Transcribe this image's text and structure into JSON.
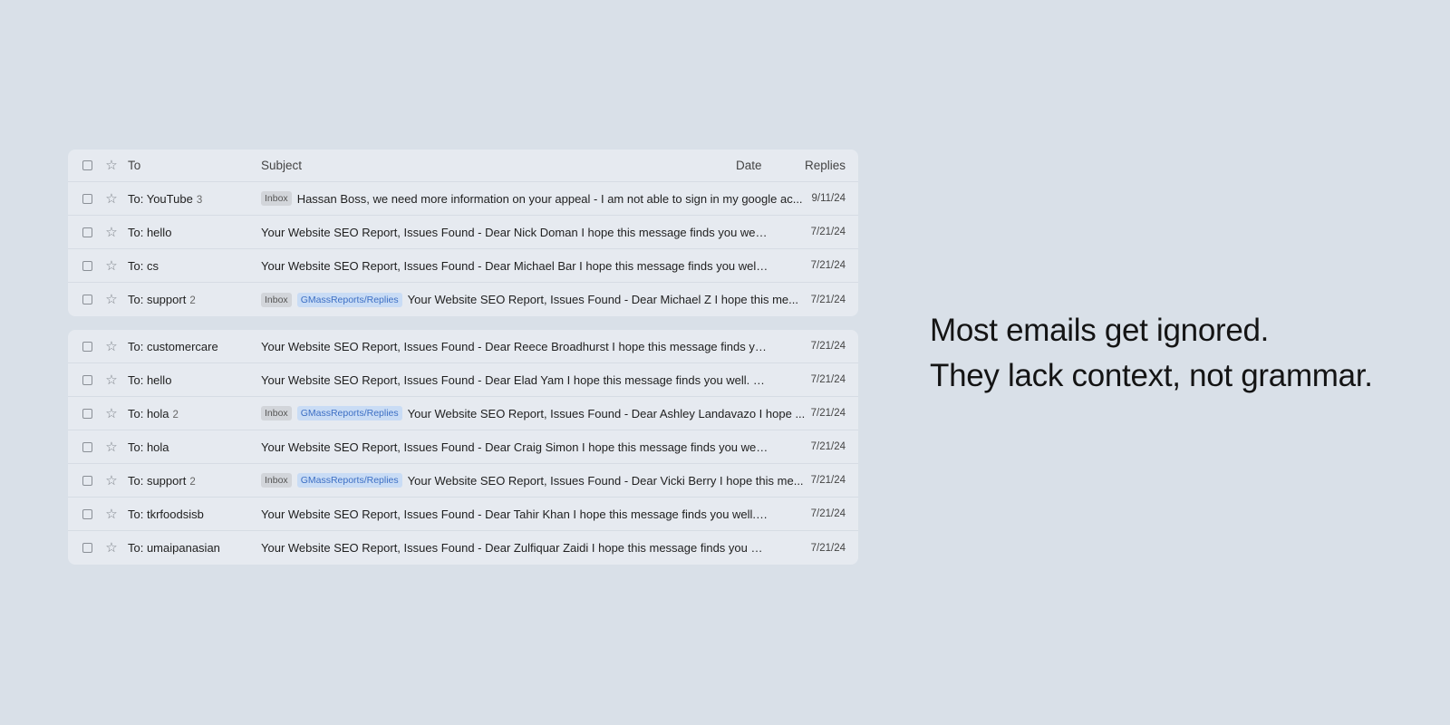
{
  "header": {
    "to_label": "To",
    "subject_label": "Subject",
    "date_label": "Date",
    "replies_label": "Replies"
  },
  "chips": {
    "inbox": "Inbox",
    "label": "GMassReports/Replies"
  },
  "rows_top": [
    {
      "to": "To: YouTube",
      "count": "3",
      "subject": "Hassan Boss, we need more information on your appeal - I am not able to sign in my google ac...",
      "date": "9/11/24"
    },
    {
      "to": "To: hello",
      "count": "",
      "subject": "Your Website SEO Report, Issues Found - Dear Nick Doman I hope this message finds you well. My na...",
      "date": "7/21/24"
    },
    {
      "to": "To: cs",
      "count": "",
      "subject": "Your Website SEO Report, Issues Found - Dear Michael Bar I hope this message finds you well. My na...",
      "date": "7/21/24"
    },
    {
      "to": "To: support",
      "count": "2",
      "subject": "Your Website SEO Report, Issues Found - Dear Michael Z I hope this me...",
      "date": "7/21/24"
    }
  ],
  "rows_bottom": [
    {
      "to": "To: customercare",
      "count": "",
      "subject": "Your Website SEO Report, Issues Found - Dear Reece Broadhurst I hope this message finds you well. ...",
      "date": "7/21/24"
    },
    {
      "to": "To: hello",
      "count": "",
      "subject": "Your Website SEO Report, Issues Found - Dear Elad Yam I hope this message finds you well. My nam...",
      "date": "7/21/24"
    },
    {
      "to": "To: hola",
      "count": "2",
      "subject": "Your Website SEO Report, Issues Found - Dear Ashley Landavazo I hope ...",
      "date": "7/21/24"
    },
    {
      "to": "To: hola",
      "count": "",
      "subject": "Your Website SEO Report, Issues Found - Dear Craig Simon I hope this message finds you well. My na...",
      "date": "7/21/24"
    },
    {
      "to": "To: support",
      "count": "2",
      "subject": "Your Website SEO Report, Issues Found - Dear Vicki Berry I hope this me...",
      "date": "7/21/24"
    },
    {
      "to": "To: tkrfoodsisb",
      "count": "",
      "subject": "Your Website SEO Report, Issues Found - Dear Tahir Khan I hope this message finds you well. My nam...",
      "date": "7/21/24"
    },
    {
      "to": "To: umaipanasian",
      "count": "",
      "subject": "Your Website SEO Report, Issues Found - Dear Zulfiquar Zaidi I hope this message finds you well. My n...",
      "date": "7/21/24"
    }
  ],
  "tagline": {
    "line1": "Most emails get ignored.",
    "line2": "They lack context, not grammar."
  },
  "icons": {
    "checkbox": "checkbox-icon",
    "star": "star-icon"
  },
  "colors": {
    "background": "#d9e0e8",
    "panel": "#e6eaf0",
    "label_chip_bg": "#c9dcf5",
    "label_chip_text": "#3d6fc4",
    "inbox_chip_bg": "#d2d5da"
  }
}
